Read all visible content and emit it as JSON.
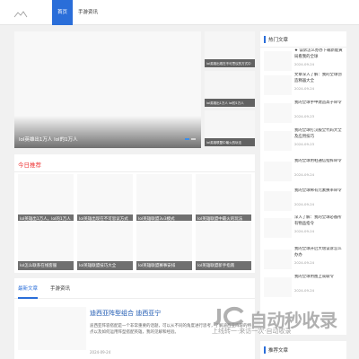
{
  "header": {
    "logo_icon": "cloud-logo-icon",
    "nav": [
      {
        "label": "首页",
        "active": true
      },
      {
        "label": "手游资讯",
        "active": false
      }
    ]
  },
  "slider": {
    "caption": "lol英雄出1万人 lol的1万人",
    "dots": 2,
    "active_dot": 0
  },
  "side_thumbs": [
    {
      "text": "lol英雄出现在不可思议的方式中"
    },
    {
      "text": "lol英雄出1万人 lol的1万人"
    },
    {
      "text": "lol英雄联盟中最火的玩法"
    }
  ],
  "today": {
    "title": "今日推荐",
    "cards": [
      {
        "text": "lol英雄出1万人，lol的1万人"
      },
      {
        "text": "lol英雄出现在不可思议方式"
      },
      {
        "text": "lol英雄联盟3v3模式"
      },
      {
        "text": "lol英雄联盟中最火的玩法"
      },
      {
        "text": "lol怎么联系在线客服"
      },
      {
        "text": "lol英雄联盟技巧大全"
      },
      {
        "text": "lol英雄联盟赛事安排"
      },
      {
        "text": "lol英雄联盟新手指南"
      }
    ]
  },
  "articles": {
    "tabs": [
      {
        "label": "最新文章",
        "active": true
      },
      {
        "label": "手游资讯",
        "active": false
      }
    ],
    "item": {
      "title": "迪西亚阵型组合 迪西亚宁",
      "excerpt": "迪西亚阵容搭配是一个非常重要的话题，可以从不同的角度进行思考，了解迪西亚阵容的特点以及如何运用阵型搭配英雄，我的见解和经验。",
      "date": "2024-09-24"
    }
  },
  "hot": {
    "title": "热门文章",
    "items": [
      {
        "text": "★ 误诉怎么办办下载新能黄局看我的全球",
        "date": "2024-09-24"
      },
      {
        "text": "文章深入了解：我的全球创造释器大全",
        "date": "2024-09-24"
      },
      {
        "text": "我的全球手中建造高子命令",
        "date": "2024-09-23"
      },
      {
        "text": "我的全球打汉服全代码大全及应用技巧",
        "date": "2024-09-23"
      },
      {
        "text": "我的全球用鞋通信指挥命令",
        "date": "2024-09-24"
      },
      {
        "text": "我的全球稀有元素换率命令",
        "date": "2024-09-24"
      },
      {
        "text": "深入了解：我的全球必备所有物品指令",
        "date": "2024-09-24"
      },
      {
        "text": "我的全球开启大增误诉怎么办办",
        "date": "2024-09-24"
      },
      {
        "text": "我的全球用图上或联令",
        "date": "2024-09-24"
      }
    ]
  },
  "recommend": {
    "title": "推荐文章"
  },
  "watermark": {
    "brand": "自动秒收录",
    "sub": "上线转一·来访一次·自动收录",
    "icon": "jc-logo-icon"
  },
  "colors": {
    "accent": "#2a6ed9",
    "today_title": "#e33333",
    "background": "#f1f1f1"
  }
}
